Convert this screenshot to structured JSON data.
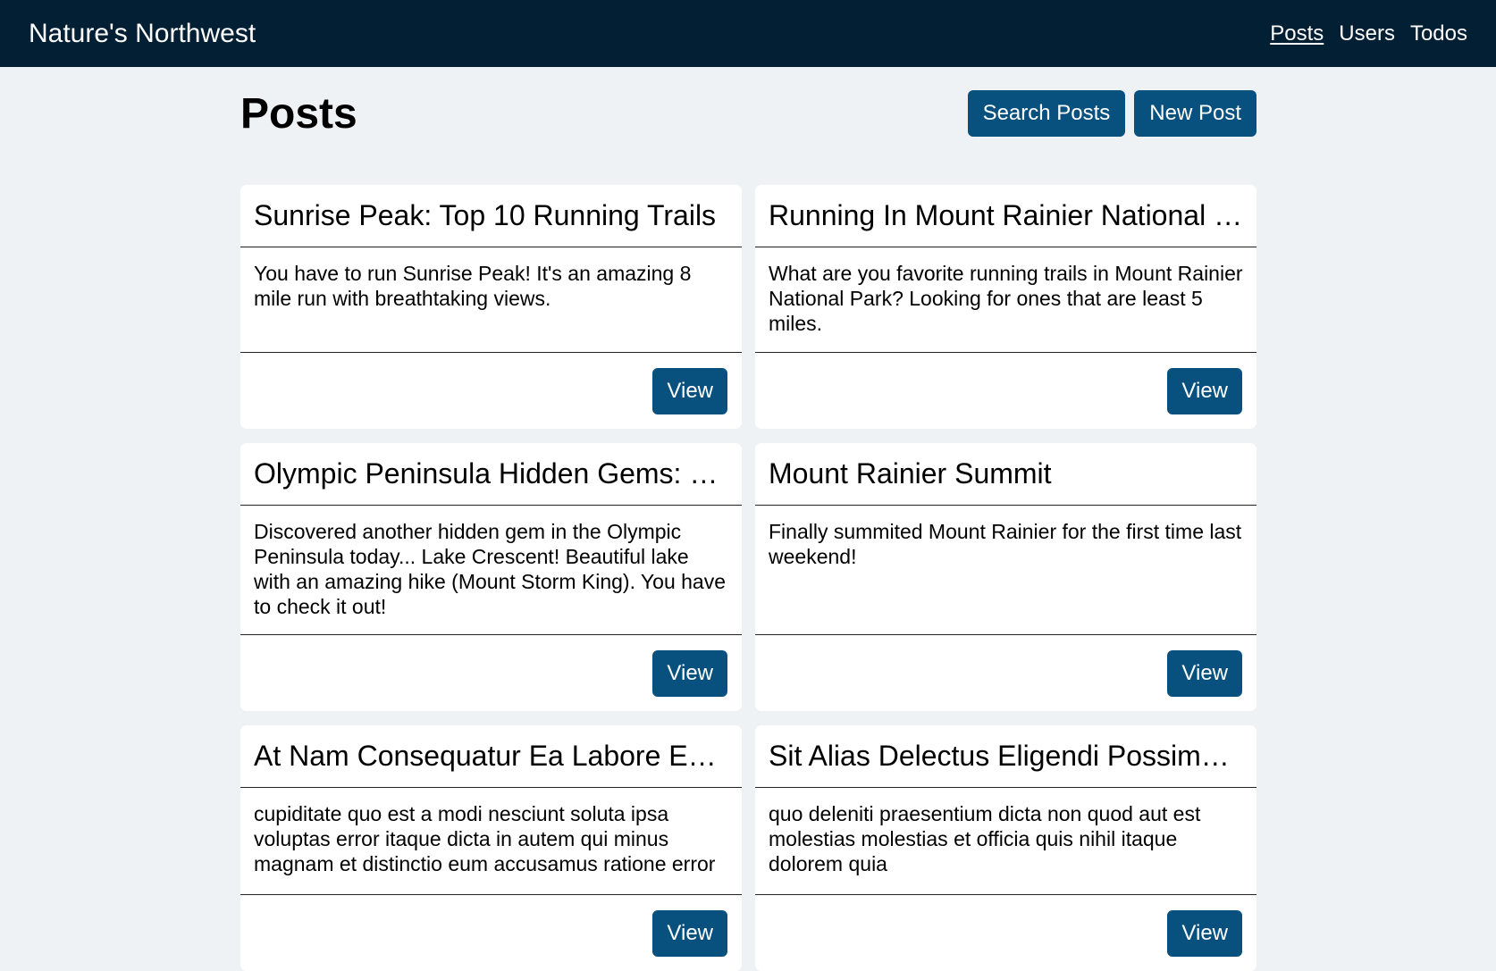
{
  "nav": {
    "brand": "Nature's Northwest",
    "links": [
      {
        "label": "Posts",
        "active": true
      },
      {
        "label": "Users",
        "active": false
      },
      {
        "label": "Todos",
        "active": false
      }
    ]
  },
  "page": {
    "title": "Posts",
    "search_label": "Search Posts",
    "new_label": "New Post"
  },
  "posts": [
    {
      "title": "Sunrise Peak: Top 10 Running Trails",
      "body": "You have to run Sunrise Peak! It's an amazing 8 mile run with breathtaking views.",
      "action": "View"
    },
    {
      "title": "Running In Mount Rainier National Pa…",
      "body": "What are you favorite running trails in Mount Rainier National Park? Looking for ones that are least 5 miles.",
      "action": "View"
    },
    {
      "title": "Olympic Peninsula Hidden Gems: La…",
      "body": "Discovered another hidden gem in the Olympic Peninsula today... Lake Crescent! Beautiful lake with an amazing hike (Mount Storm King). You have to check it out!",
      "action": "View"
    },
    {
      "title": "Mount Rainier Summit",
      "body": "Finally summited Mount Rainier for the first time last weekend!",
      "action": "View"
    },
    {
      "title": "At Nam Consequatur Ea Labore Ea H…",
      "body": "cupiditate quo est a modi nesciunt soluta ipsa voluptas error itaque dicta in autem qui minus magnam et distinctio eum accusamus ratione error",
      "action": "View"
    },
    {
      "title": "Sit Alias Delectus Eligendi Possimus …",
      "body": "quo deleniti praesentium dicta non quod aut est molestias molestias et officia quis nihil itaque dolorem quia",
      "action": "View"
    }
  ],
  "colors": {
    "navbar_bg": "#021f33",
    "page_bg": "#eef2f5",
    "button_bg": "#08517f"
  }
}
